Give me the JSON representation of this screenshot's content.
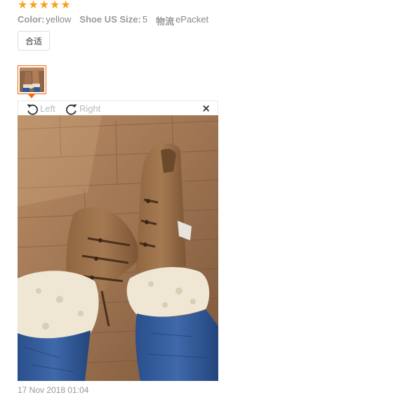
{
  "rating": {
    "stars": 5,
    "max": 5,
    "star_glyph": "★",
    "color": "#f7a21b"
  },
  "attributes": [
    {
      "label": "Color:",
      "value": "yellow"
    },
    {
      "label": "Shoe US Size:",
      "value": "5"
    },
    {
      "label": "物流",
      "value": "ePacket"
    }
  ],
  "tag": {
    "label": "合适"
  },
  "viewer": {
    "rotate_left_label": "Left",
    "rotate_right_label": "Right",
    "close_glyph": "×",
    "accent_color": "#ff6600"
  },
  "footer": {
    "text": "17 Nov 2018 01:04"
  }
}
